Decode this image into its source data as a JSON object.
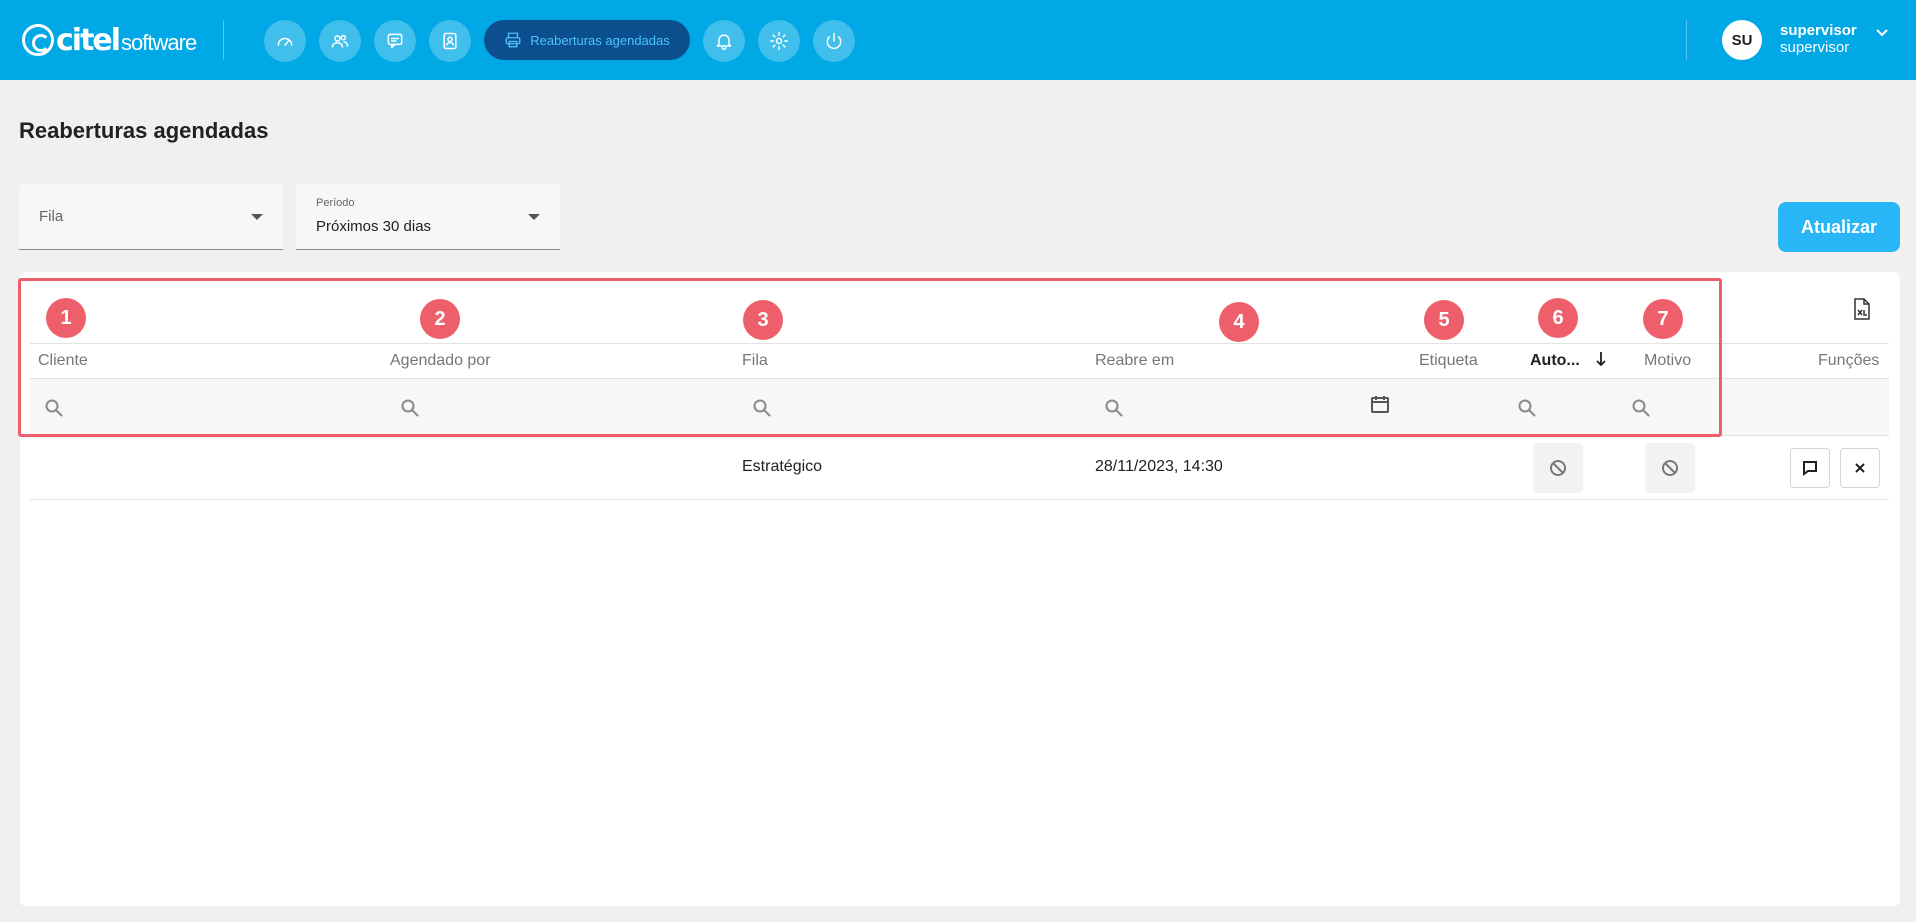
{
  "header": {
    "logo_main": "citel",
    "logo_sub": "software",
    "nav": {
      "dashboard_icon": "gauge-icon",
      "users_icon": "users-icon",
      "chat_icon": "chat-icon",
      "contacts_icon": "contacts-icon",
      "active_label": "Reaberturas agendadas",
      "active_icon": "printer-icon",
      "notifications_icon": "bell-icon",
      "settings_icon": "gear-icon",
      "power_icon": "power-icon"
    },
    "user": {
      "initials": "SU",
      "name": "supervisor",
      "role": "supervisor"
    }
  },
  "page": {
    "title": "Reaberturas agendadas"
  },
  "filters": {
    "fila": {
      "placeholder": "Fila"
    },
    "periodo": {
      "label": "Período",
      "value": "Próximos 30 dias"
    },
    "refresh_label": "Atualizar"
  },
  "table": {
    "columns": {
      "cliente": "Cliente",
      "agendado_por": "Agendado por",
      "fila": "Fila",
      "reabre_em": "Reabre em",
      "etiqueta": "Etiqueta",
      "automatico": "Auto...",
      "motivo": "Motivo",
      "funcoes": "Funções"
    },
    "rows": [
      {
        "cliente": "",
        "agendado_por": "",
        "fila": "Estratégico",
        "reabre_em": "28/11/2023, 14:30",
        "etiqueta": ""
      }
    ]
  },
  "annotations": [
    "1",
    "2",
    "3",
    "4",
    "5",
    "6",
    "7"
  ],
  "colors": {
    "topbar": "#00a8e6",
    "active_nav": "#0c4f8f",
    "accent_button": "#29b6f6",
    "annotation": "#ee5f6c"
  }
}
